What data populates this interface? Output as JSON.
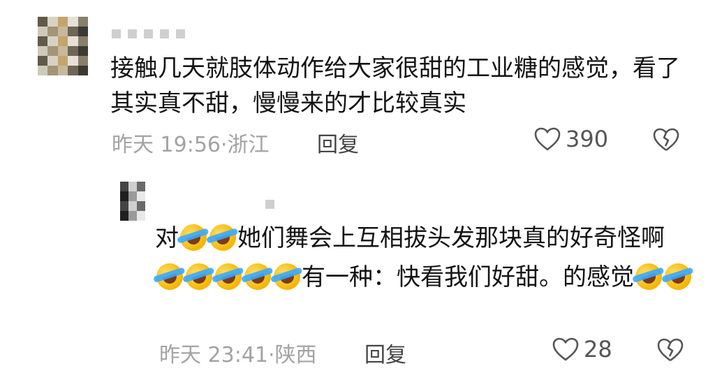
{
  "comments": [
    {
      "username": "",
      "text_parts": [
        "接触几天就肢体动作给大家很甜的工业糖的感觉，看了其实真不甜，慢慢来的才比较真实"
      ],
      "time_location": "昨天 19:56·浙江",
      "reply_label": "回复",
      "likes": "390"
    },
    {
      "username": "",
      "text_parts": [
        "对",
        "emoji:2",
        "她们舞会上互相拔头发那块真的好奇怪啊",
        "emoji:5",
        "有一种：快看我们好甜。的感觉",
        "emoji:2"
      ],
      "time_location": "昨天 23:41·陕西",
      "reply_label": "回复",
      "likes": "28"
    }
  ],
  "icons": {
    "like": "heart-outline-icon",
    "dislike": "broken-heart-icon",
    "emoji": "rofl-emoji"
  },
  "colors": {
    "meta": "#a3a3a3",
    "icon": "#555555"
  }
}
